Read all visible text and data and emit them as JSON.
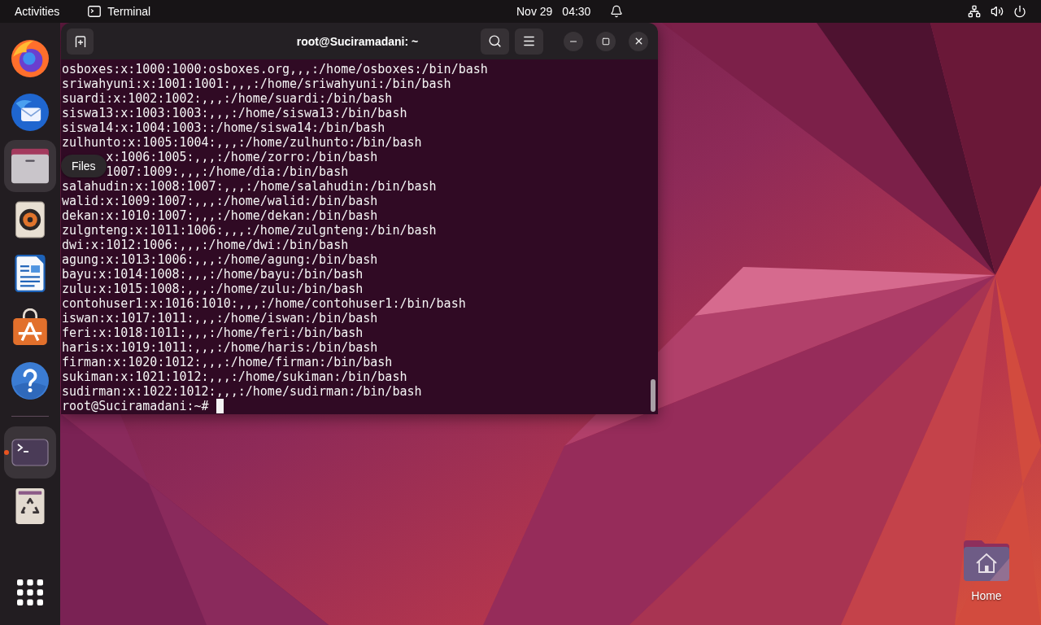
{
  "top_bar": {
    "activities": "Activities",
    "app_menu": "Terminal",
    "clock": {
      "date": "Nov 29",
      "time": "04:30"
    }
  },
  "dock": {
    "favorites": [
      {
        "kind": "browser",
        "highlighted": false,
        "running": false
      },
      {
        "kind": "mail",
        "highlighted": false,
        "running": false
      },
      {
        "kind": "files",
        "highlighted": true,
        "running": false,
        "tooltip": "Files"
      },
      {
        "kind": "music",
        "highlighted": false,
        "running": false
      },
      {
        "kind": "writer",
        "highlighted": false,
        "running": false
      },
      {
        "kind": "software",
        "highlighted": false,
        "running": false
      },
      {
        "kind": "help",
        "highlighted": false,
        "running": false
      }
    ],
    "open_apps": [
      {
        "kind": "terminal",
        "highlighted": true,
        "running": true
      }
    ],
    "trash": {
      "highlighted": false
    }
  },
  "terminal": {
    "title": "root@Suciramadani: ~",
    "lines": [
      {
        "text": "osboxes:x:1000:1000:osboxes.org,,,:/home/osboxes:/bin/bash",
        "covered": false
      },
      {
        "text": "sriwahyuni:x:1001:1001:,,,:/home/sriwahyuni:/bin/bash",
        "covered": false
      },
      {
        "text": "suardi:x:1002:1002:,,,:/home/suardi:/bin/bash",
        "covered": false
      },
      {
        "text": "siswa13:x:1003:1003:,,,:/home/siswa13:/bin/bash",
        "covered": false
      },
      {
        "text": "siswa14:x:1004:1003::/home/siswa14:/bin/bash",
        "covered": false
      },
      {
        "text": "zulhunto:x:1005:1004:,,,:/home/zulhunto:/bin/bash",
        "covered": false
      },
      {
        "text": "x:1006:1005:,,,:/home/zorro:/bin/bash",
        "covered": true
      },
      {
        "text": "1007:1009:,,,:/home/dia:/bin/bash",
        "covered": true
      },
      {
        "text": "salahudin:x:1008:1007:,,,:/home/salahudin:/bin/bash",
        "covered": false
      },
      {
        "text": "walid:x:1009:1007:,,,:/home/walid:/bin/bash",
        "covered": false
      },
      {
        "text": "dekan:x:1010:1007:,,,:/home/dekan:/bin/bash",
        "covered": false
      },
      {
        "text": "zulgnteng:x:1011:1006:,,,:/home/zulgnteng:/bin/bash",
        "covered": false
      },
      {
        "text": "dwi:x:1012:1006:,,,:/home/dwi:/bin/bash",
        "covered": false
      },
      {
        "text": "agung:x:1013:1006:,,,:/home/agung:/bin/bash",
        "covered": false
      },
      {
        "text": "bayu:x:1014:1008:,,,:/home/bayu:/bin/bash",
        "covered": false
      },
      {
        "text": "zulu:x:1015:1008:,,,:/home/zulu:/bin/bash",
        "covered": false
      },
      {
        "text": "contohuser1:x:1016:1010:,,,:/home/contohuser1:/bin/bash",
        "covered": false
      },
      {
        "text": "iswan:x:1017:1011:,,,:/home/iswan:/bin/bash",
        "covered": false
      },
      {
        "text": "feri:x:1018:1011:,,,:/home/feri:/bin/bash",
        "covered": false
      },
      {
        "text": "haris:x:1019:1011:,,,:/home/haris:/bin/bash",
        "covered": false
      },
      {
        "text": "firman:x:1020:1012:,,,:/home/firman:/bin/bash",
        "covered": false
      },
      {
        "text": "sukiman:x:1021:1012:,,,:/home/sukiman:/bin/bash",
        "covered": false
      },
      {
        "text": "sudirman:x:1022:1012:,,,:/home/sudirman:/bin/bash",
        "covered": false
      }
    ],
    "prompt": "root@Suciramadani:~#"
  },
  "desktop": {
    "icons": [
      {
        "label": "Home"
      }
    ]
  }
}
